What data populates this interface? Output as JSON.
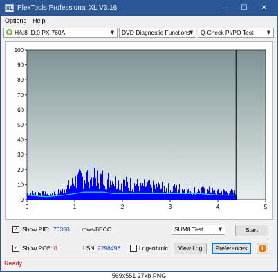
{
  "window": {
    "title": "PlexTools Professional XL V3.16",
    "app_icon_text": "XL",
    "controls": {
      "minimize": "—",
      "maximize": "☐",
      "close": "✕"
    }
  },
  "menu": {
    "items": [
      {
        "label": "Options"
      },
      {
        "label": "Help"
      }
    ]
  },
  "toolbar": {
    "drive": "HA:8 ID:0  PX-760A",
    "function": "DVD Diagnostic Functions",
    "test": "Q-Check PI/PO Test"
  },
  "chart_data": {
    "type": "area",
    "x_ticks": [
      "0",
      "1",
      "2",
      "3",
      "4",
      "5"
    ],
    "y_ticks": [
      "0",
      "10",
      "20",
      "30",
      "40",
      "50",
      "60",
      "70",
      "80",
      "90",
      "100"
    ],
    "xlim": [
      0,
      5
    ],
    "ylim": [
      0,
      100
    ],
    "end_marker_x": 4.38,
    "series": [
      {
        "name": "PIE",
        "color": "#0000ff",
        "x": [
          0,
          0.2,
          0.4,
          0.6,
          0.8,
          0.9,
          1.0,
          1.1,
          1.2,
          1.3,
          1.4,
          1.5,
          1.6,
          1.7,
          1.8,
          1.9,
          2.0,
          2.2,
          2.4,
          2.6,
          2.8,
          3.0,
          3.2,
          3.4,
          3.6,
          3.8,
          4.0,
          4.2,
          4.38
        ],
        "y": [
          6,
          6,
          5,
          6,
          10,
          13,
          17,
          19,
          21,
          22,
          21,
          20,
          19,
          18,
          17,
          16,
          15,
          14,
          13,
          12,
          11,
          10,
          10,
          9,
          8,
          8,
          7,
          7,
          6
        ]
      },
      {
        "name": "PIE avg",
        "color": "#20d0d0",
        "x": [
          0,
          0.4,
          0.8,
          1.0,
          1.2,
          1.4,
          1.6,
          1.8,
          2.0,
          2.4,
          2.8,
          3.2,
          3.6,
          4.0,
          4.38
        ],
        "y": [
          3,
          2,
          3,
          4,
          5,
          5,
          5,
          4,
          4,
          4,
          4,
          4,
          4,
          3,
          3
        ]
      }
    ],
    "background_top": "#7d9494",
    "background_bottom": "#e9efef"
  },
  "controls": {
    "show_pie_label": "Show PIE:",
    "pie_value": "70350",
    "pie_unit": "rows/8ECC",
    "show_poe_label": "Show POE:",
    "poe_value": "0",
    "lsn_label": "LSN:",
    "lsn_value": "2298496",
    "logarithmic_label": "Logarthmic",
    "mode_select": "SUM8 Test",
    "start_button": "Start",
    "view_log_button": "View Log",
    "preferences_button": "Preferences",
    "info_button": "i",
    "check_mark": "✓"
  },
  "status": {
    "text": "Ready"
  },
  "image_caption": "569x551  27kb  PNG"
}
